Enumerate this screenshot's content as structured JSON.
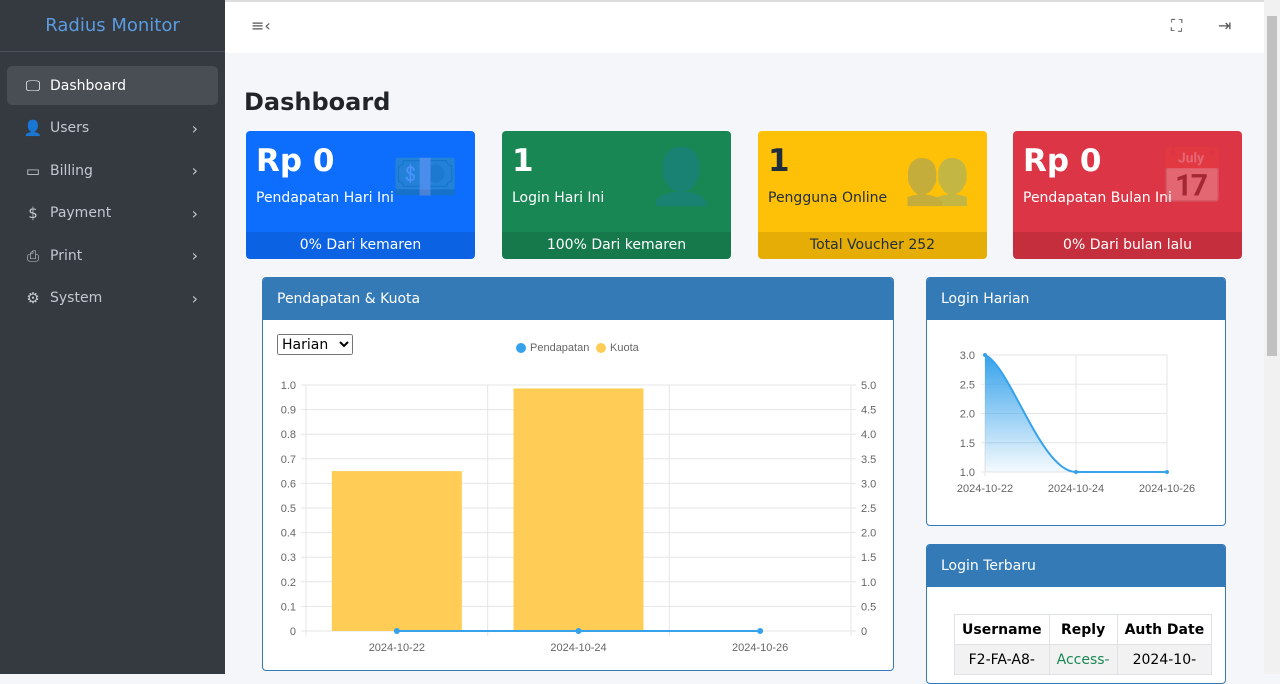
{
  "sidebar": {
    "brand": "Radius Monitor",
    "items": [
      {
        "label": "Dashboard",
        "icon": "monitor-icon",
        "glyph": "🖵",
        "active": true
      },
      {
        "label": "Users",
        "icon": "user-icon",
        "glyph": "👤"
      },
      {
        "label": "Billing",
        "icon": "credit-card-icon",
        "glyph": "▭"
      },
      {
        "label": "Payment",
        "icon": "money-icon",
        "glyph": "$"
      },
      {
        "label": "Print",
        "icon": "printer-icon",
        "glyph": "⎙"
      },
      {
        "label": "System",
        "icon": "gear-icon",
        "glyph": "⚙"
      }
    ]
  },
  "header": {
    "menu_icon": "≡‹",
    "fullscreen_icon": "⛶",
    "logout_icon": "⇥"
  },
  "page_title": "Dashboard",
  "cards": [
    {
      "value": "Rp 0",
      "label": "Pendapatan Hari Ini",
      "footer": "0% Dari kemaren",
      "color": "#0d6efd",
      "icon": "money-bill-icon",
      "glyph": "💵"
    },
    {
      "value": "1",
      "label": "Login Hari Ini",
      "footer": "100% Dari kemaren",
      "color": "#198754",
      "icon": "user-login-icon",
      "glyph": "👤"
    },
    {
      "value": "1",
      "label": "Pengguna Online",
      "footer": "Total Voucher 252",
      "color": "#ffc107",
      "icon": "users-icon",
      "glyph": "👥"
    },
    {
      "value": "Rp 0",
      "label": "Pendapatan Bulan Ini",
      "footer": "0% Dari bulan lalu",
      "color": "#dc3545",
      "icon": "calendar-icon",
      "glyph": "📅"
    }
  ],
  "chart_panel": {
    "title": "Pendapatan & Kuota",
    "select_value": "Harian"
  },
  "login_panel": {
    "title": "Login Harian"
  },
  "recent_panel": {
    "title": "Login Terbaru",
    "columns": [
      "Username",
      "Reply",
      "Auth Date"
    ],
    "rows": [
      [
        "F2-FA-A8-",
        "Access-",
        "2024-10-"
      ]
    ]
  },
  "chart_data": [
    {
      "type": "bar",
      "categories": [
        "2024-10-22",
        "2024-10-24",
        "2024-10-26"
      ],
      "series": [
        {
          "name": "Pendapatan",
          "type": "line",
          "axis": "left",
          "values": [
            0,
            0,
            0
          ],
          "color": "#36a2eb"
        },
        {
          "name": "Kuota",
          "type": "bar",
          "axis": "right",
          "values": [
            3.25,
            4.93,
            0
          ],
          "color": "#ffcd56"
        }
      ],
      "ylim_left": [
        0,
        1
      ],
      "yticks_left": [
        "0",
        "0.1",
        "0.2",
        "0.3",
        "0.4",
        "0.5",
        "0.6",
        "0.7",
        "0.8",
        "0.9",
        "1.0"
      ],
      "ylim_right": [
        0,
        5
      ],
      "yticks_right": [
        "0",
        "0.5",
        "1.0",
        "1.5",
        "2.0",
        "2.5",
        "3.0",
        "3.5",
        "4.0",
        "4.5",
        "5.0"
      ],
      "legend": "top",
      "grid": true
    },
    {
      "type": "area",
      "categories": [
        "2024-10-22",
        "2024-10-24",
        "2024-10-26"
      ],
      "values": [
        3,
        1,
        1
      ],
      "color": "#36a2eb",
      "ylim": [
        1,
        3
      ],
      "yticks": [
        "1.0",
        "1.5",
        "2.0",
        "2.5",
        "3.0"
      ],
      "grid": true
    }
  ]
}
